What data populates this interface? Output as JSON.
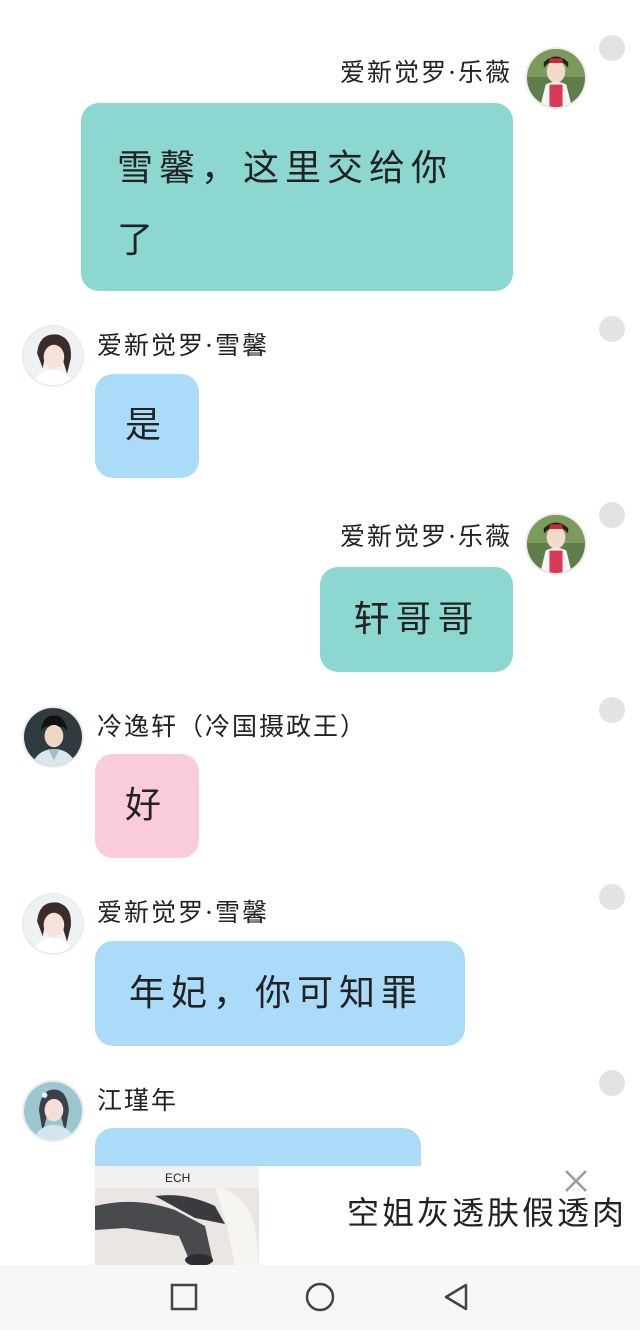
{
  "messages": [
    {
      "sender": "爱新觉罗·乐薇",
      "text": "雪馨，这里交给你了",
      "side": "right",
      "color": "teal"
    },
    {
      "sender": "爱新觉罗·雪馨",
      "text": "是",
      "side": "left",
      "color": "blue"
    },
    {
      "sender": "爱新觉罗·乐薇",
      "text": "轩哥哥",
      "side": "right",
      "color": "teal"
    },
    {
      "sender": "冷逸轩（冷国摄政王）",
      "text": "好",
      "side": "left",
      "color": "pink"
    },
    {
      "sender": "爱新觉罗·雪馨",
      "text": "年妃，你可知罪",
      "side": "left",
      "color": "blue"
    },
    {
      "sender": "江瑾年",
      "text": "",
      "side": "left",
      "color": "blue"
    }
  ],
  "ad": {
    "text": "空姐灰透肤假透肉",
    "close_icon": "close-icon",
    "image_icon": "stockings-product-photo"
  },
  "navbar": {
    "recents_icon": "square-icon",
    "home_icon": "circle-icon",
    "back_icon": "triangle-back-icon"
  },
  "colors": {
    "teal_bubble": "#8cd8d0",
    "blue_bubble": "#aadcfa",
    "pink_bubble": "#facbdb",
    "read_dot": "#e3e3e3",
    "navbar_bg": "#f7f7f7"
  }
}
